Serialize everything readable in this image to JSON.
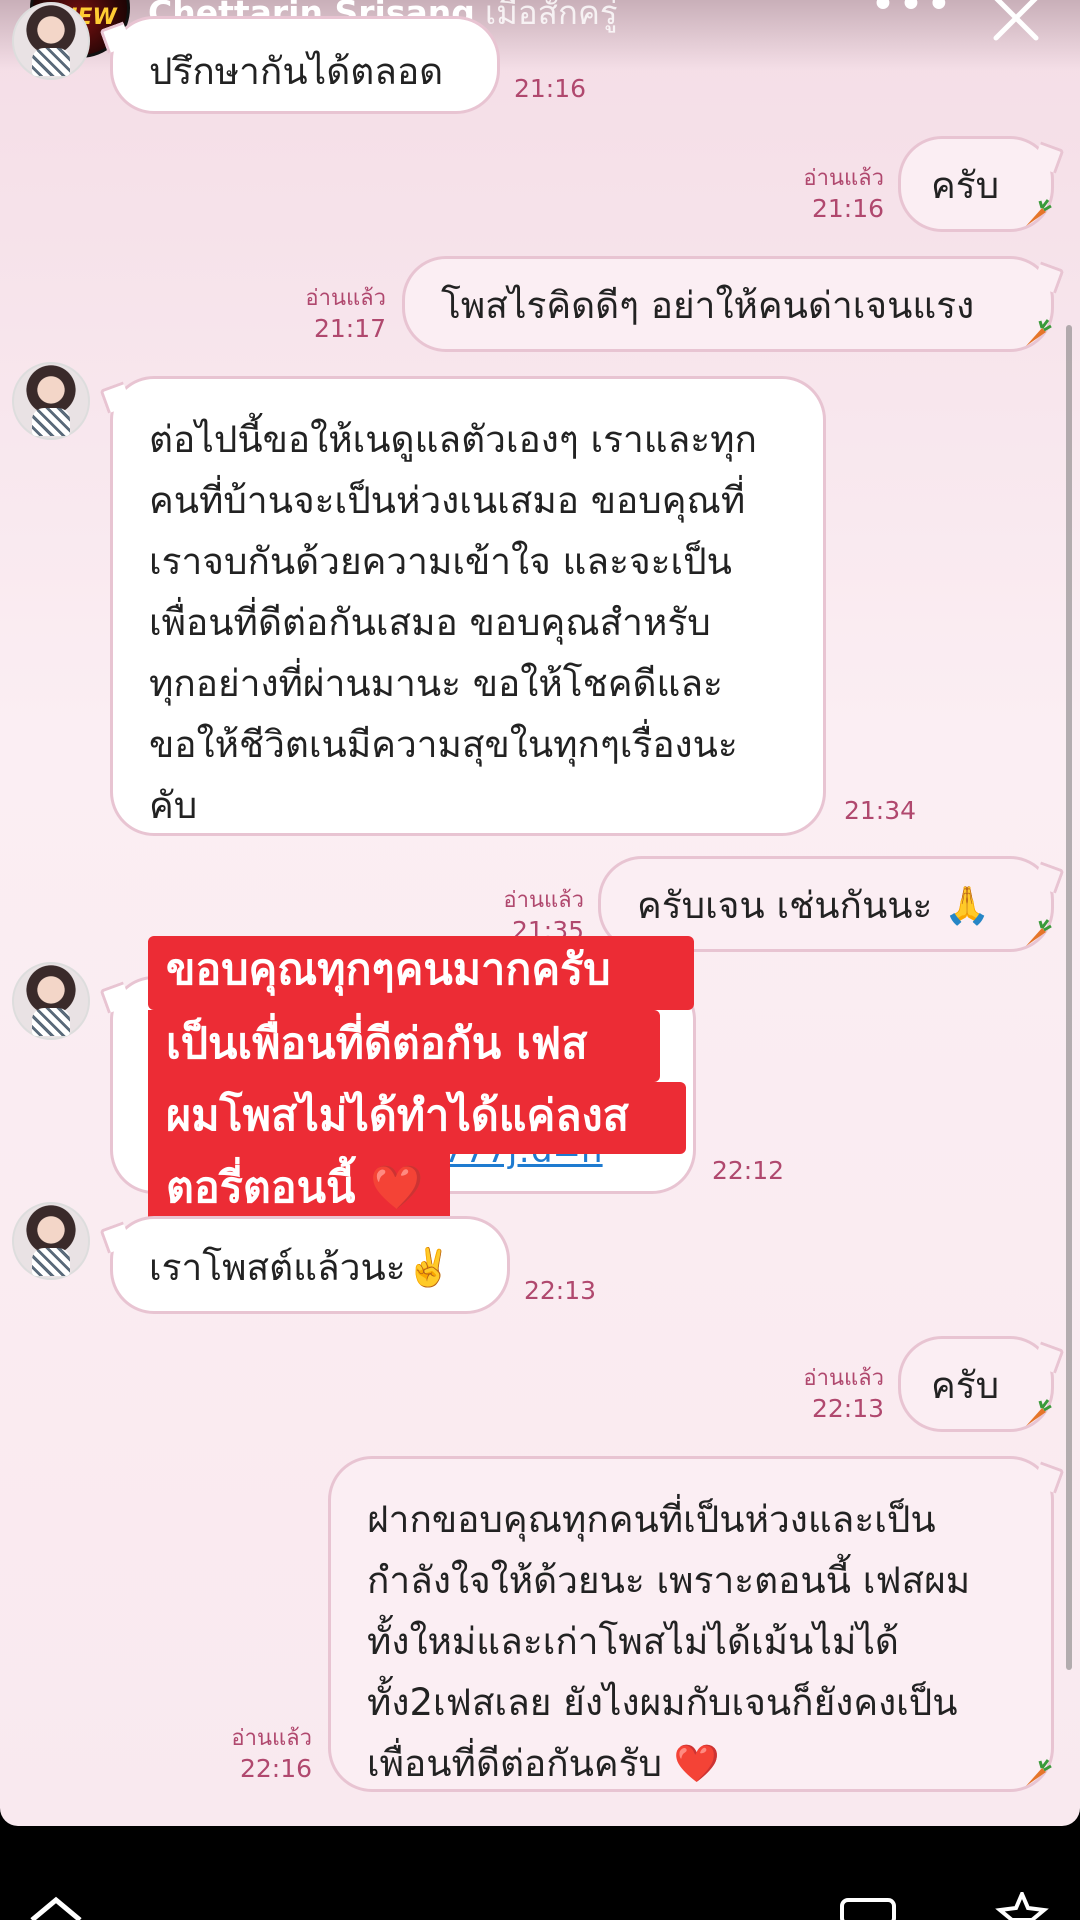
{
  "header": {
    "name": "Chettarin Srisang",
    "time": "เมื่อสักครู่",
    "more": "•••"
  },
  "messages": [
    {
      "side": "in",
      "text": "ปรึกษากันได้ตลอด",
      "time": "21:16"
    },
    {
      "side": "out",
      "text": "ครับ",
      "read": "อ่านแล้ว",
      "time": "21:16"
    },
    {
      "side": "out",
      "text": "โพสไรคิดดีๆ อย่าให้คนด่าเจนแรง",
      "read": "อ่านแล้ว",
      "time": "21:17"
    },
    {
      "side": "in",
      "text": "ต่อไปนี้ขอให้เนดูแลตัวเองๆ เราและทุก\nคนที่บ้านจะเป็นห่วงเนเสมอ ขอบคุณที่\nเราจบกันด้วยความเข้าใจ และจะเป็น\nเพื่อนที่ดีต่อกันเสมอ ขอบคุณสำหรับ\nทุกอย่างที่ผ่านมานะ ขอให้โชคดีและ\nขอให้ชีวิตเนมีความสุขในทุกๆเรื่องนะ\nคับ",
      "time": "21:34"
    },
    {
      "side": "out",
      "text": "ครับเจน เช่นกันนะ 🙏",
      "read": "อ่านแล้ว",
      "time": "21:35"
    },
    {
      "side": "in",
      "text": "/",
      "link": "777j!d=n",
      "time": "22:12"
    },
    {
      "side": "in",
      "text": "เราโพสต์แล้วนะ✌️",
      "time": "22:13"
    },
    {
      "side": "out",
      "text": "ครับ",
      "read": "อ่านแล้ว",
      "time": "22:13"
    },
    {
      "side": "out",
      "text": "ฝากขอบคุณทุกคนที่เป็นห่วงและเป็น\nกำลังใจให้ด้วยนะ เพราะตอนนี้ เฟสผม\nทั้งใหม่และเก่าโพสไม่ได้เม้นไม่ได้\nทั้ง2เฟสเลย ยังไงผมกับเจนก็ยังคงเป็น\nเพื่อนที่ดีต่อกันครับ ❤️",
      "read": "อ่านแล้ว",
      "time": "22:16"
    }
  ],
  "overlay_caption": {
    "line1": "ขอบคุณทุกๆคนมากครับ",
    "line2": "เป็นเพื่อนที่ดีต่อกัน เฟส",
    "line3": "ผมโพสไม่ได้ทำได้แค่ลงส",
    "line4": "ตอรี่ตอนนี้ ❤️"
  },
  "icons": {
    "close": "close-icon",
    "more": "more-icon",
    "carrot": "carrot-sticker-icon",
    "home": "home-icon",
    "messenger": "message-icon",
    "star": "star-icon"
  },
  "colors": {
    "bubble_border": "#e8c4d2",
    "meta_text": "#b0486e",
    "overlay_bg": "#ec2c35"
  }
}
